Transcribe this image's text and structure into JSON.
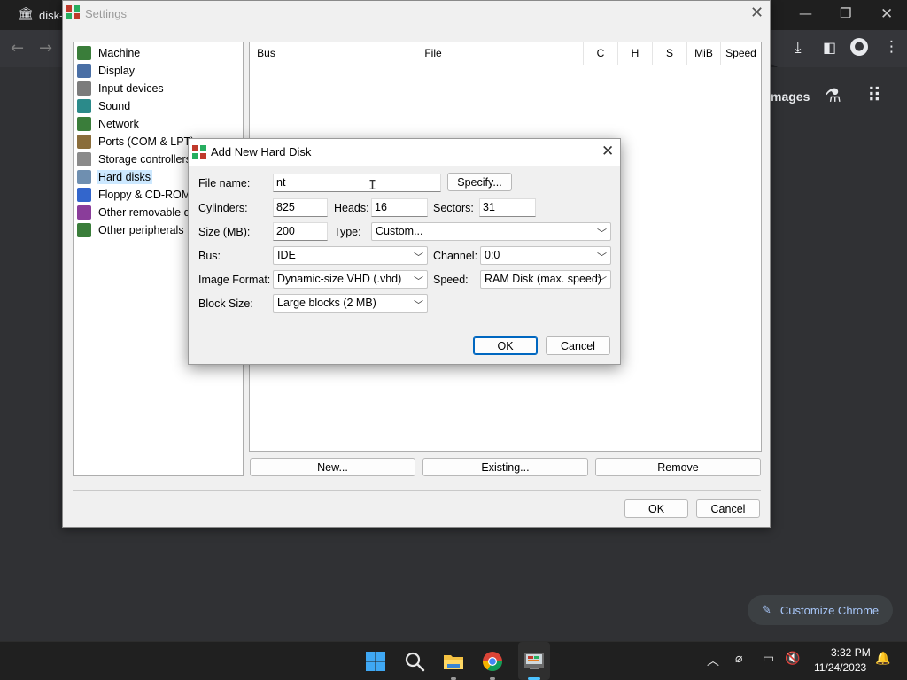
{
  "chrome": {
    "tab_title": "disk-",
    "images_label": "mages",
    "customize_label": "Customize Chrome"
  },
  "settings": {
    "title": "Settings",
    "tree": [
      {
        "label": "Machine",
        "icon": "machine-icon",
        "color": "#3a7d3a"
      },
      {
        "label": "Display",
        "icon": "display-icon",
        "color": "#4a6fa5"
      },
      {
        "label": "Input devices",
        "icon": "input-devices-icon",
        "color": "#7b7b7b"
      },
      {
        "label": "Sound",
        "icon": "sound-icon",
        "color": "#2b8a8a"
      },
      {
        "label": "Network",
        "icon": "network-icon",
        "color": "#3a7d3a"
      },
      {
        "label": "Ports (COM & LPT)",
        "icon": "ports-icon",
        "color": "#8a6d3b"
      },
      {
        "label": "Storage controllers",
        "icon": "storage-controllers-icon",
        "color": "#8a8a8a"
      },
      {
        "label": "Hard disks",
        "icon": "hard-disk-icon",
        "color": "#6f8fb0"
      },
      {
        "label": "Floppy & CD-ROM d",
        "icon": "floppy-icon",
        "color": "#3366cc"
      },
      {
        "label": "Other removable de",
        "icon": "removable-icon",
        "color": "#8a3d9a"
      },
      {
        "label": "Other peripherals",
        "icon": "peripherals-icon",
        "color": "#3a7d3a"
      }
    ],
    "selected_index": 7,
    "columns": [
      "Bus",
      "File",
      "C",
      "H",
      "S",
      "MiB",
      "Speed"
    ],
    "buttons": {
      "new": "New...",
      "existing": "Existing...",
      "remove": "Remove",
      "ok": "OK",
      "cancel": "Cancel"
    }
  },
  "dialog": {
    "title": "Add New Hard Disk",
    "file_name_label": "File name:",
    "file_name_value": "nt",
    "specify_label": "Specify...",
    "cylinders_label": "Cylinders:",
    "cylinders_value": "825",
    "heads_label": "Heads:",
    "heads_value": "16",
    "sectors_label": "Sectors:",
    "sectors_value": "31",
    "size_label": "Size (MB):",
    "size_value": "200",
    "type_label": "Type:",
    "type_value": "Custom...",
    "bus_label": "Bus:",
    "bus_value": "IDE",
    "channel_label": "Channel:",
    "channel_value": "0:0",
    "image_format_label": "Image Format:",
    "image_format_value": "Dynamic-size VHD (.vhd)",
    "speed_label": "Speed:",
    "speed_value": "RAM Disk (max. speed)",
    "block_size_label": "Block Size:",
    "block_size_value": "Large blocks (2 MB)",
    "ok_label": "OK",
    "cancel_label": "Cancel"
  },
  "taskbar": {
    "time": "3:32 PM",
    "date": "11/24/2023"
  }
}
